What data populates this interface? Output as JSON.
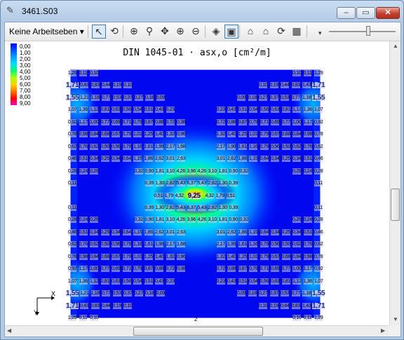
{
  "window": {
    "title": "3461.S03"
  },
  "toolbar": {
    "workplane_select": "Keine Arbeitseben ▾",
    "buttons": [
      {
        "name": "select-pointer-button",
        "icon": "↖",
        "active": true
      },
      {
        "name": "rotate-view-button",
        "icon": "⟲",
        "active": false
      },
      {
        "name": "zoom-window-button",
        "icon": "⊕",
        "active": false
      },
      {
        "name": "zoom-button",
        "icon": "⚲",
        "active": false
      },
      {
        "name": "pan-button",
        "icon": "✥",
        "active": false
      },
      {
        "name": "zoom-in-button",
        "icon": "⊕",
        "active": false
      },
      {
        "name": "zoom-out-button",
        "icon": "⊖",
        "active": false
      },
      {
        "name": "view-3d-button",
        "icon": "◈",
        "active": false
      },
      {
        "name": "view-top-button",
        "icon": "▣",
        "active": true
      },
      {
        "name": "view-house-button",
        "icon": "⌂",
        "active": false
      },
      {
        "name": "view-house2-button",
        "icon": "⌂",
        "active": false
      },
      {
        "name": "refresh-button",
        "icon": "⟳",
        "active": false
      },
      {
        "name": "grid-button",
        "icon": "▦",
        "active": false
      }
    ]
  },
  "plot": {
    "title": "DIN 1045-01 · asx,o [cm²/m]",
    "legend": {
      "levels": [
        "0,00",
        "1,00",
        "2,00",
        "3,00",
        "4,00",
        "5,00",
        "6,00",
        "7,00",
        "8,00",
        "9,00"
      ],
      "colors": [
        "#0000ff",
        "#0050ff",
        "#00a0ff",
        "#00e0ff",
        "#00ff70",
        "#b0ff00",
        "#ffd000",
        "#ff7000",
        "#ff0000",
        "#ff00c0"
      ]
    },
    "axis": {
      "x": "X",
      "y": "Y"
    },
    "scale_marker": "2",
    "rows": [
      {
        "left": [
          "1,29",
          "0,11",
          "0,10"
        ],
        "right": [
          "0,10",
          "0,11",
          "1,29"
        ]
      },
      {
        "big_left": "1,71",
        "left": [
          "0,43",
          "0,83",
          "0,44",
          "0,19",
          "0,10"
        ],
        "right": [
          "0,10",
          "0,19",
          "0,44",
          "0,83",
          "1,43"
        ],
        "big_right": "1,71"
      },
      {
        "big_left": "1,55",
        "left": [
          "1,21",
          "1,18",
          "0,77",
          "0,53",
          "0,37",
          "0,27",
          "0,18",
          "0,09"
        ],
        "right": [
          "0,09",
          "0,18",
          "0,27",
          "0,37",
          "0,53",
          "0,77",
          "1,18"
        ],
        "big_right": "1,55"
      },
      {
        "left": [
          "1,07",
          "1,36",
          "1,12",
          "0,81",
          "0,63",
          "0,56",
          "0,54",
          "0,51",
          "0,43",
          "0,23"
        ],
        "right": [
          "0,23",
          "0,43",
          "0,51",
          "0,54",
          "0,56",
          "0,63",
          "0,81",
          "1,12",
          "1,36",
          "1,07"
        ]
      },
      {
        "left": [
          "0,92",
          "1,17",
          "1,00",
          "0,77",
          "0,69",
          "0,71",
          "0,79",
          "0,87",
          "0,88",
          "0,72",
          "0,38"
        ],
        "right": [
          "0,72",
          "0,88",
          "0,87",
          "0,79",
          "0,71",
          "0,69",
          "0,77",
          "1,00",
          "1,17",
          "0,92"
        ]
      },
      {
        "left": [
          "0,78",
          "0,98",
          "0,84",
          "0,68",
          "0,67",
          "0,79",
          "1,01",
          "1,25",
          "1,40",
          "1,32",
          "0,96"
        ],
        "right": [
          "1,32",
          "1,40",
          "1,25",
          "1,01",
          "0,79",
          "0,67",
          "0,68",
          "0,84",
          "0,98",
          "0,78"
        ]
      },
      {
        "left": [
          "0,62",
          "0,76",
          "0,62",
          "0,50",
          "0,56",
          "0,79",
          "1,16",
          "1,61",
          "1,99",
          "2,17",
          "1,68"
        ],
        "right": [
          "2,17",
          "1,99",
          "1,61",
          "1,16",
          "0,79",
          "0,56",
          "0,50",
          "0,62",
          "0,76",
          "0,62"
        ]
      },
      {
        "left": [
          "0,46",
          "0,51",
          "0,34",
          "0,25",
          "0,34",
          "0,64",
          "1,15",
          "1,86",
          "2,62",
          "3,01",
          "2,63"
        ],
        "right": [
          "3,01",
          "2,62",
          "1,86",
          "1,15",
          "0,64",
          "0,34",
          "0,25",
          "0,34",
          "0,51",
          "0,46"
        ]
      },
      {
        "left": [
          "0,28",
          "0,24",
          "0,29"
        ],
        "mid": [
          "0,32",
          "0,90",
          "1,81",
          "3,10",
          "4,26",
          "3,96",
          "4,26",
          "3,10",
          "1,81",
          "0,90",
          "0,32"
        ],
        "right": [
          "0,29",
          "0,24",
          "0,28"
        ]
      },
      {
        "left": [
          "0,11"
        ],
        "mid": [
          "0,39",
          "1,30",
          "2,82",
          "5,43",
          "6,37",
          "5,43",
          "2,82",
          "1,30",
          "0,39"
        ],
        "right": [
          "0,11"
        ]
      },
      {
        "mid": [
          "0,51",
          "1,79",
          "4,32"
        ],
        "peak": "9,25",
        "mid2": [
          "4,32",
          "1,79",
          "0,51"
        ]
      },
      {
        "left": [
          "0,11"
        ],
        "mid": [
          "0,39",
          "1,30",
          "2,82",
          "5,43",
          "6,37",
          "5,43",
          "2,82",
          "1,30",
          "0,39"
        ],
        "right": [
          "0,11"
        ]
      },
      {
        "left": [
          "0,28",
          "0,24",
          "0,29"
        ],
        "mid": [
          "0,32",
          "0,90",
          "1,81",
          "3,10",
          "4,26",
          "3,96",
          "4,26",
          "3,10",
          "1,81",
          "0,90",
          "0,32"
        ],
        "right": [
          "0,29",
          "0,24",
          "0,28"
        ]
      },
      {
        "left": [
          "0,46",
          "0,51",
          "0,34",
          "0,25",
          "0,34",
          "0,64",
          "1,15",
          "1,86",
          "2,62",
          "3,01",
          "2,63"
        ],
        "right": [
          "3,01",
          "2,62",
          "1,86",
          "1,15",
          "0,64",
          "0,34",
          "0,25",
          "0,34",
          "0,51",
          "0,46"
        ]
      },
      {
        "left": [
          "0,62",
          "0,76",
          "0,62",
          "0,50",
          "0,56",
          "0,79",
          "1,16",
          "1,61",
          "1,99",
          "2,17",
          "1,68"
        ],
        "right": [
          "2,17",
          "1,99",
          "1,61",
          "1,16",
          "0,79",
          "0,56",
          "0,50",
          "0,62",
          "0,76",
          "0,62"
        ]
      },
      {
        "left": [
          "0,78",
          "0,98",
          "0,84",
          "0,68",
          "0,67",
          "0,79",
          "1,01",
          "1,25",
          "1,40",
          "1,32",
          "0,96"
        ],
        "right": [
          "1,32",
          "1,40",
          "1,25",
          "1,01",
          "0,79",
          "0,67",
          "0,68",
          "0,84",
          "0,98",
          "0,78"
        ]
      },
      {
        "left": [
          "0,92",
          "1,17",
          "1,00",
          "0,77",
          "0,69",
          "0,71",
          "0,79",
          "0,87",
          "0,88",
          "0,72",
          "0,38"
        ],
        "right": [
          "0,72",
          "0,88",
          "0,87",
          "0,79",
          "0,71",
          "0,69",
          "0,77",
          "1,00",
          "1,17",
          "0,92"
        ]
      },
      {
        "left": [
          "1,07",
          "1,36",
          "1,12",
          "0,81",
          "0,63",
          "0,56",
          "0,54",
          "0,51",
          "0,43",
          "0,23"
        ],
        "right": [
          "0,23",
          "0,43",
          "0,51",
          "0,54",
          "0,56",
          "0,63",
          "0,81",
          "1,12",
          "1,36",
          "1,07"
        ]
      },
      {
        "big_left": "1,55",
        "left": [
          "1,21",
          "1,18",
          "0,77",
          "0,53",
          "0,37",
          "0,27",
          "0,18",
          "0,09"
        ],
        "right": [
          "0,09",
          "0,18",
          "0,27",
          "0,37",
          "0,53",
          "0,77",
          "1,18"
        ],
        "big_right": "1,55"
      },
      {
        "big_left": "1,71",
        "left": [
          "0,43",
          "0,83",
          "0,44",
          "0,19",
          "0,10"
        ],
        "right": [
          "0,10",
          "0,19",
          "0,44",
          "0,83",
          "1,43"
        ],
        "big_right": "1,71"
      },
      {
        "left": [
          "1,29",
          "0,11",
          "0,10"
        ],
        "right": [
          "0,10",
          "0,11",
          "1,29"
        ]
      }
    ]
  }
}
